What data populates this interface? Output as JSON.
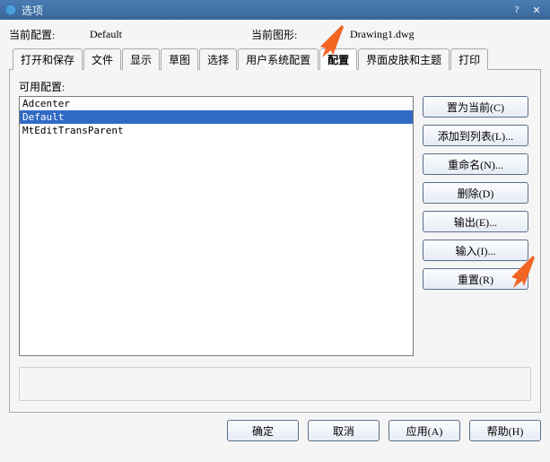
{
  "titlebar": {
    "title": "选项"
  },
  "header": {
    "currentProfileLabel": "当前配置:",
    "currentProfile": "Default",
    "currentDrawingLabel": "当前图形:",
    "currentDrawing": "Drawing1.dwg"
  },
  "tabs": {
    "open_save": "打开和保存",
    "file": "文件",
    "display": "显示",
    "sketch": "草图",
    "select": "选择",
    "user_sys": "用户系统配置",
    "config": "配置",
    "skin_theme": "界面皮肤和主题",
    "print": "打印"
  },
  "panel": {
    "availableLabel": "可用配置:",
    "items": [
      "Adcenter",
      "Default",
      "MtEditTransParent"
    ],
    "selectedIndex": 1
  },
  "buttons": {
    "set_current": "置为当前(C)",
    "add_to_list": "添加到列表(L)...",
    "rename": "重命名(N)...",
    "delete": "删除(D)",
    "export": "输出(E)...",
    "import": "输入(I)...",
    "reset": "重置(R)"
  },
  "footer": {
    "ok": "确定",
    "cancel": "取消",
    "apply": "应用(A)",
    "help": "帮助(H)"
  }
}
